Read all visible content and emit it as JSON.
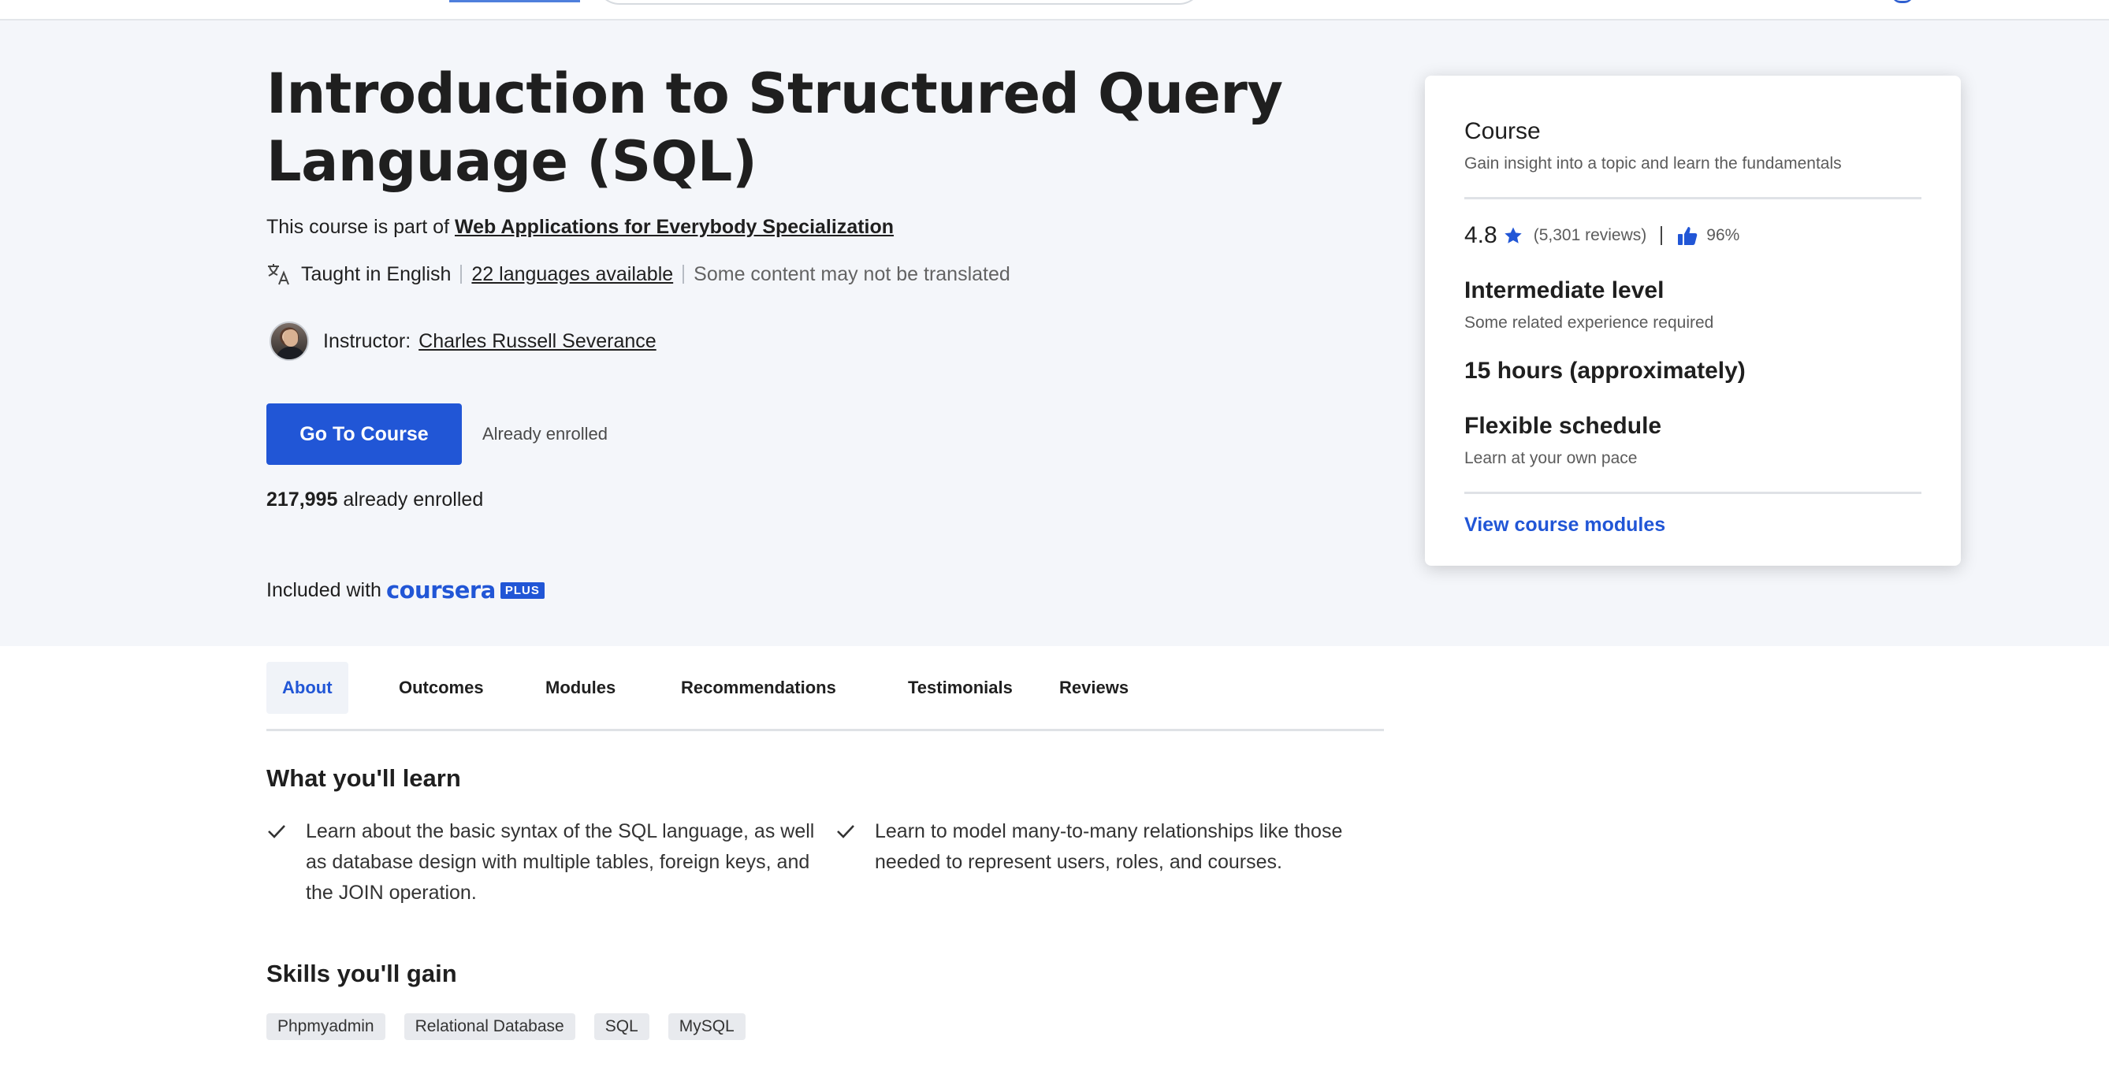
{
  "hero": {
    "title": "Introduction to Structured Query Language (SQL)",
    "part_of_prefix": "This course is part of",
    "specialization_link": "Web Applications for Everybody Specialization",
    "taught_in": "Taught in English",
    "languages_link": "22 languages available",
    "translation_note": "Some content may not be translated",
    "instructor_label": "Instructor:",
    "instructor_name": "Charles Russell Severance",
    "cta_label": "Go To Course",
    "enrolled_note": "Already enrolled",
    "enroll_count": "217,995",
    "enroll_suffix": "already enrolled",
    "included_prefix": "Included with",
    "brand_name": "coursera",
    "brand_plus": "PLUS"
  },
  "card": {
    "title": "Course",
    "subtitle": "Gain insight into a topic and learn the fundamentals",
    "rating": "4.8",
    "reviews": "(5,301 reviews)",
    "approval": "96%",
    "level": "Intermediate level",
    "level_note": "Some related experience required",
    "duration": "15 hours (approximately)",
    "schedule": "Flexible schedule",
    "schedule_note": "Learn at your own pace",
    "modules_link": "View course modules"
  },
  "tabs": [
    {
      "label": "About",
      "active": true
    },
    {
      "label": "Outcomes"
    },
    {
      "label": "Modules"
    },
    {
      "label": "Recommendations"
    },
    {
      "label": "Testimonials"
    },
    {
      "label": "Reviews"
    }
  ],
  "learn": {
    "heading": "What you'll learn",
    "items": [
      "Learn about the basic syntax of the SQL language, as well as database design with multiple tables, foreign keys, and the JOIN operation.",
      "Learn to model many-to-many relationships like those needed to represent users, roles, and courses."
    ]
  },
  "skills": {
    "heading": "Skills you'll gain",
    "items": [
      "Phpmyadmin",
      "Relational Database",
      "SQL",
      "MySQL"
    ]
  },
  "colors": {
    "accent": "#2156d6",
    "hero_bg": "#f4f6fa",
    "text": "#1f1f1f"
  },
  "icons": [
    "translate-icon",
    "star-icon",
    "thumbs-up-icon",
    "check-icon"
  ]
}
